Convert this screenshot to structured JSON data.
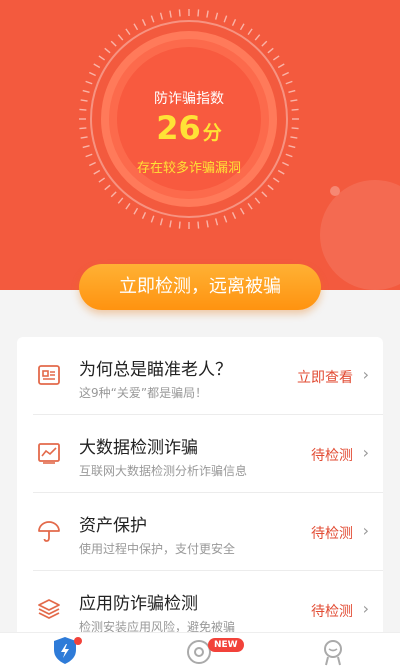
{
  "gauge": {
    "title": "防诈骗指数",
    "score": "26",
    "unit": "分",
    "subtitle": "存在较多诈骗漏洞"
  },
  "cta": {
    "label": "立即检测，远离被骗"
  },
  "items": [
    {
      "icon": "article-icon",
      "title": "为何总是瞄准老人？",
      "subtitle": "这9种“关爱”都是骗局！",
      "action": "立即查看"
    },
    {
      "icon": "chart-icon",
      "title": "大数据检测诈骗",
      "subtitle": "互联网大数据检测分析诈骗信息",
      "action": "待检测"
    },
    {
      "icon": "umbrella-icon",
      "title": "资产保护",
      "subtitle": "使用过程中保护，支付更安全",
      "action": "待检测"
    },
    {
      "icon": "layers-icon",
      "title": "应用防诈骗检测",
      "subtitle": "检测安装应用风险，避免被骗",
      "action": "待检测"
    }
  ],
  "tabbar": {
    "new_badge": "NEW",
    "tabs": [
      {
        "icon": "shield-icon",
        "active": true
      },
      {
        "icon": "discover-icon",
        "active": false
      },
      {
        "icon": "profile-icon",
        "active": false
      }
    ]
  },
  "colors": {
    "hero": "#f35a3e",
    "accent": "#e24b33",
    "score": "#ffe236",
    "cta": "#ff9c1c"
  }
}
